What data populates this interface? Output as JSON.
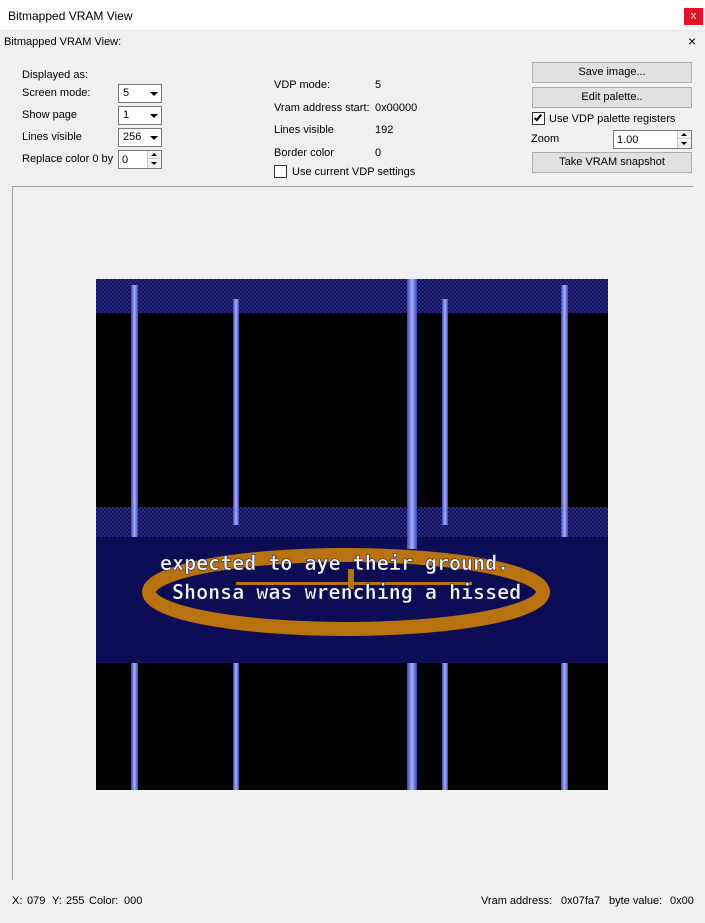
{
  "window": {
    "title": "Bitmapped VRAM View",
    "close_glyph": "x"
  },
  "panel": {
    "header": "Bitmapped VRAM View:",
    "close_glyph": "×"
  },
  "settings": {
    "displayed_as_label": "Displayed as:",
    "screen_mode_label": "Screen mode:",
    "screen_mode_value": "5",
    "show_page_label": "Show page",
    "show_page_value": "1",
    "lines_visible_label": "Lines visible",
    "lines_visible_value": "256",
    "replace_color_label": "Replace color 0 by",
    "replace_color_value": "0"
  },
  "vdp_info": {
    "vdp_mode_label": "VDP mode:",
    "vdp_mode_value": "5",
    "vram_start_label": "Vram address start:",
    "vram_start_value": "0x00000",
    "lines_visible_label": "Lines visible",
    "lines_visible_value": "192",
    "border_color_label": "Border color",
    "border_color_value": "0",
    "use_current_label": "Use current VDP settings",
    "use_current_checked": false
  },
  "actions": {
    "save_image": "Save image...",
    "edit_palette": "Edit palette..",
    "use_vdp_palette_label": "Use VDP  palette registers",
    "use_vdp_palette_checked": true,
    "zoom_label": "Zoom",
    "zoom_value": "1.00",
    "take_snapshot": "Take VRAM snapshot"
  },
  "screen_text": {
    "line1": "expected to aye their ground.",
    "line2": "Shonsa was wrenching a hissed"
  },
  "status": {
    "x_label": "X:",
    "x_value": "079",
    "y_label": "Y:",
    "y_value": "255",
    "color_label": "Color:",
    "color_value": "000",
    "vram_address_label": "Vram address:",
    "vram_address_value": "0x07fa7",
    "byte_value_label": "byte value:",
    "byte_value": "0x00"
  },
  "colors": {
    "screen_top": "#1a1a66",
    "screen_band": "#0d0d55",
    "pillar": "#5a6ad6",
    "ring": "#b8730e"
  }
}
